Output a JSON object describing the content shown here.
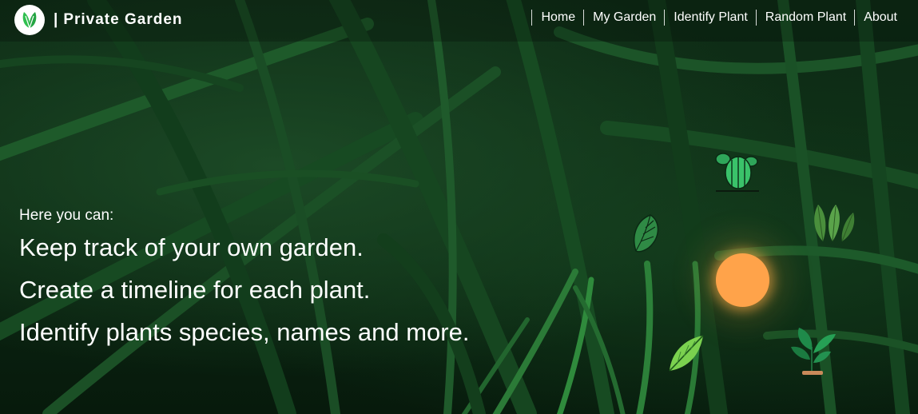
{
  "brand": {
    "separator": "|",
    "title": "Private Garden"
  },
  "nav": {
    "items": [
      "Home",
      "My Garden",
      "Identify Plant",
      "Random Plant",
      "About"
    ]
  },
  "hero": {
    "intro": "Here you can:",
    "features": [
      "Keep track of your own garden.",
      "Create a timeline for each plant.",
      "Identify plants species, names and more."
    ]
  },
  "icons": {
    "logo": "leaf-logo-icon",
    "decorations": [
      "cactus-icon",
      "monstera-leaf-icon",
      "caladium-leaves-icon",
      "sun-icon",
      "green-leaf-icon",
      "potted-plant-icon"
    ]
  },
  "colors": {
    "background": "#0b2612",
    "accent_green": "#2fbf4f",
    "sun": "#ffa34a",
    "text": "#ffffff"
  }
}
